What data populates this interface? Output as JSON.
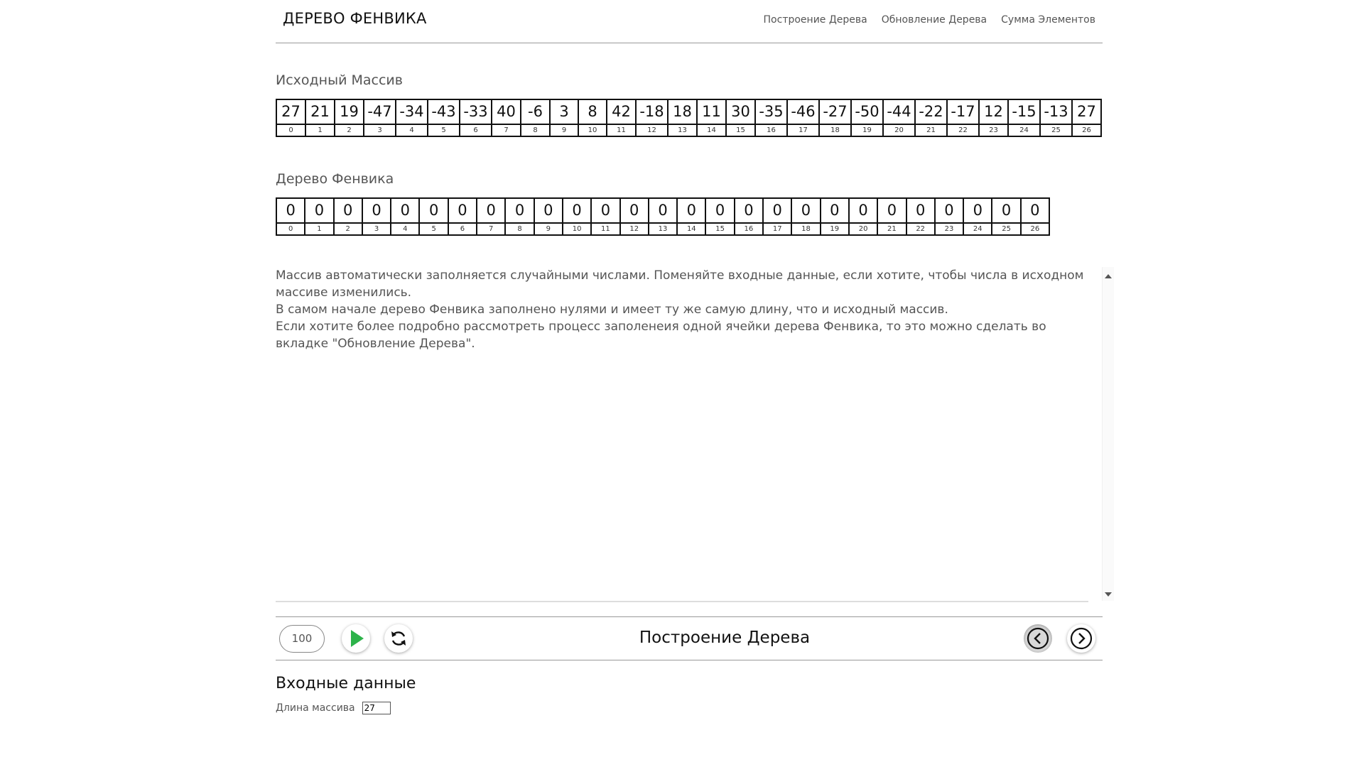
{
  "header": {
    "brand": "ДЕРЕВО ФЕНВИКА",
    "nav": [
      "Построение Дерева",
      "Обновление Дерева",
      "Сумма Элементов"
    ]
  },
  "source_array": {
    "title": "Исходный Массив",
    "values": [
      "27",
      "21",
      "19",
      "-47",
      "-34",
      "-43",
      "-33",
      "40",
      "-6",
      "3",
      "8",
      "42",
      "-18",
      "18",
      "11",
      "30",
      "-35",
      "-46",
      "-27",
      "-50",
      "-44",
      "-22",
      "-17",
      "12",
      "-15",
      "-13",
      "27"
    ],
    "indices": [
      "0",
      "1",
      "2",
      "3",
      "4",
      "5",
      "6",
      "7",
      "8",
      "9",
      "10",
      "11",
      "12",
      "13",
      "14",
      "15",
      "16",
      "17",
      "18",
      "19",
      "20",
      "21",
      "22",
      "23",
      "24",
      "25",
      "26"
    ]
  },
  "fenwick_tree": {
    "title": "Дерево Фенвика",
    "values": [
      "0",
      "0",
      "0",
      "0",
      "0",
      "0",
      "0",
      "0",
      "0",
      "0",
      "0",
      "0",
      "0",
      "0",
      "0",
      "0",
      "0",
      "0",
      "0",
      "0",
      "0",
      "0",
      "0",
      "0",
      "0",
      "0",
      "0"
    ],
    "indices": [
      "0",
      "1",
      "2",
      "3",
      "4",
      "5",
      "6",
      "7",
      "8",
      "9",
      "10",
      "11",
      "12",
      "13",
      "14",
      "15",
      "16",
      "17",
      "18",
      "19",
      "20",
      "21",
      "22",
      "23",
      "24",
      "25",
      "26"
    ]
  },
  "description": {
    "lines": [
      "Массив автоматически заполняется случайными числами. Поменяйте входные данные, если хотите, чтобы числа в исходном массиве изменились.",
      "В самом начале дерево Фенвика заполнено нулями и имеет ту же самую длину, что и исходный массив.",
      "Если хотите более подробно рассмотреть процесс заполенеия одной ячейки дерева Фенвика, то это можно сделать во вкладке \"Обновление Дерева\"."
    ]
  },
  "controls": {
    "speed": "100",
    "step_title": "Построение Дерева",
    "play_color": "#2db34a"
  },
  "input": {
    "title": "Входные данные",
    "length_label": "Длина массива",
    "length_value": "27"
  }
}
